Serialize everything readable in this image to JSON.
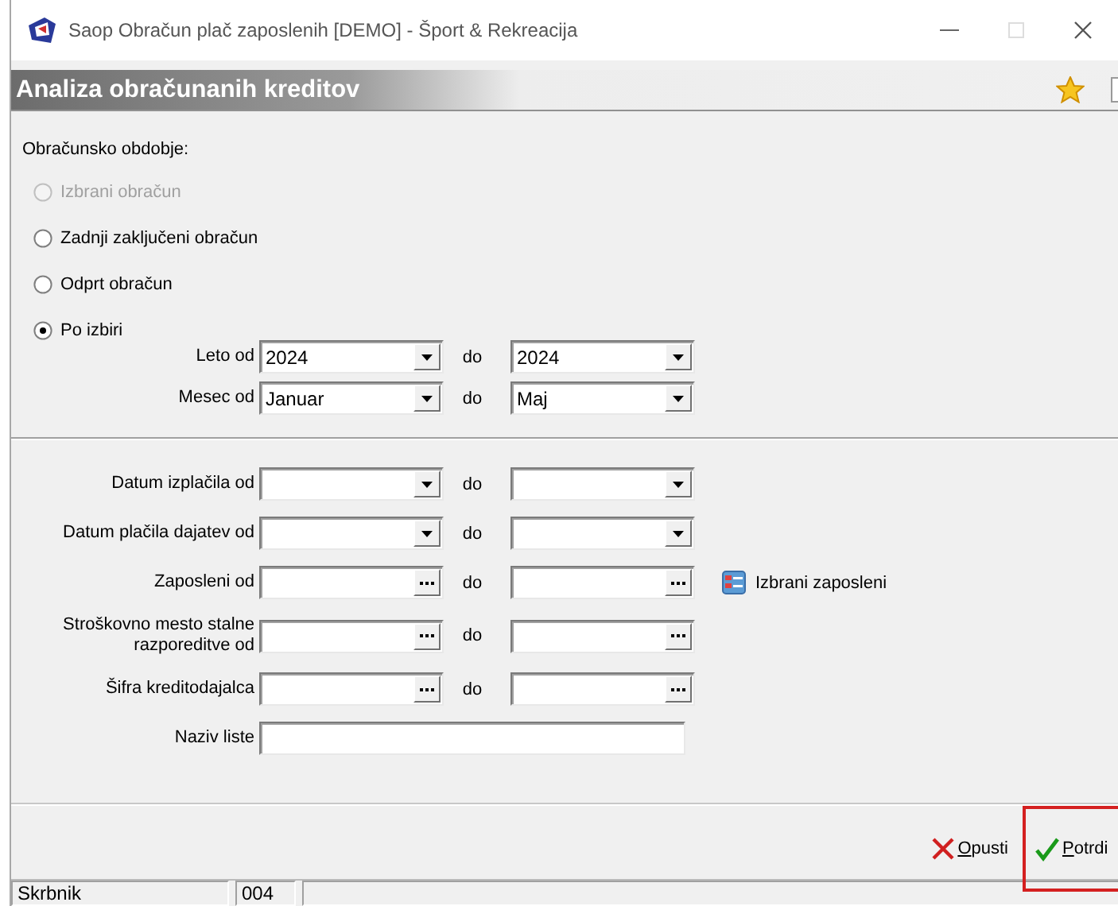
{
  "window": {
    "title": "Saop Obračun plač zaposlenih [DEMO] - Šport & Rekreacija"
  },
  "header": {
    "title": "Analiza obračunanih kreditov"
  },
  "period": {
    "label": "Obračunsko obdobje:",
    "options": [
      {
        "label": "Izbrani obračun",
        "selected": false,
        "disabled": true
      },
      {
        "label": "Zadnji zaključeni obračun",
        "selected": false,
        "disabled": false
      },
      {
        "label": "Odprt obračun",
        "selected": false,
        "disabled": false
      },
      {
        "label": "Po izbiri",
        "selected": true,
        "disabled": false
      }
    ]
  },
  "range_rows": [
    {
      "label": "Leto od",
      "to_label": "do",
      "from": {
        "kind": "dropdown",
        "value": "2024"
      },
      "to": {
        "kind": "dropdown",
        "value": "2024"
      }
    },
    {
      "label": "Mesec od",
      "to_label": "do",
      "from": {
        "kind": "dropdown",
        "value": "Januar"
      },
      "to": {
        "kind": "dropdown",
        "value": "Maj"
      }
    }
  ],
  "filter_rows": [
    {
      "label": "Datum izplačila od",
      "to_label": "do",
      "from": {
        "kind": "dropdown"
      },
      "to": {
        "kind": "dropdown"
      }
    },
    {
      "label": "Datum plačila dajatev od",
      "to_label": "do",
      "from": {
        "kind": "dropdown"
      },
      "to": {
        "kind": "dropdown"
      }
    },
    {
      "label": "Zaposleni od",
      "to_label": "do",
      "from": {
        "kind": "lookup"
      },
      "to": {
        "kind": "lookup"
      },
      "action": "Izbrani zaposleni"
    },
    {
      "label": "Stroškovno mesto stalne razporeditve od",
      "to_label": "do",
      "from": {
        "kind": "lookup"
      },
      "to": {
        "kind": "lookup"
      }
    },
    {
      "label": "Šifra kreditodajalca",
      "to_label": "do",
      "from": {
        "kind": "lookup"
      },
      "to": {
        "kind": "lookup"
      }
    }
  ],
  "list_name": {
    "label": "Naziv liste"
  },
  "buttons": [
    {
      "label": "Opusti",
      "kind": "cancel",
      "highlighted": false
    },
    {
      "label": "Potrdi",
      "kind": "confirm",
      "highlighted": true
    }
  ],
  "status_bar": [
    "Skrbnik",
    "004"
  ]
}
